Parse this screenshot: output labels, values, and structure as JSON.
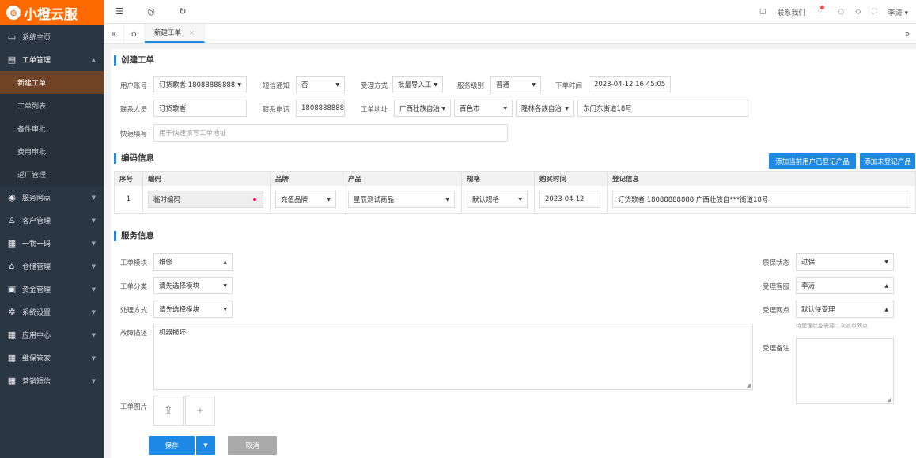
{
  "brand": {
    "name": "小橙云服",
    "mark": "⊙"
  },
  "sidebar": {
    "items": [
      {
        "label": "系统主页",
        "icon": "monitor-icon",
        "glyph": "▭"
      },
      {
        "label": "工单管理",
        "icon": "document-icon",
        "glyph": "▤",
        "open": true,
        "children": [
          "新建工单",
          "工单列表",
          "备件审批",
          "费用审批",
          "返厂管理"
        ]
      },
      {
        "label": "服务网点",
        "icon": "globe-icon",
        "glyph": "◉"
      },
      {
        "label": "客户管理",
        "icon": "user-icon",
        "glyph": "♙"
      },
      {
        "label": "一物一码",
        "icon": "grid-icon",
        "glyph": "▦"
      },
      {
        "label": "仓储管理",
        "icon": "bank-icon",
        "glyph": "⌂"
      },
      {
        "label": "资金管理",
        "icon": "money-icon",
        "glyph": "▣"
      },
      {
        "label": "系统设置",
        "icon": "gear-icon",
        "glyph": "✲"
      },
      {
        "label": "应用中心",
        "icon": "apps-icon",
        "glyph": "▦"
      },
      {
        "label": "维保管家",
        "icon": "apps-icon",
        "glyph": "▦"
      },
      {
        "label": "营销短信",
        "icon": "apps-icon",
        "glyph": "▦"
      }
    ]
  },
  "topbar": {
    "contact": "联系我们",
    "user": "李涛"
  },
  "tabs": {
    "active": "新建工单"
  },
  "create": {
    "title": "创建工单",
    "user_account_label": "用户账号",
    "user_account": "订货歌者 18088888888",
    "sms_label": "短信通知",
    "sms": "否",
    "accept_label": "受理方式",
    "accept": "批量导入工",
    "level_label": "服务级别",
    "level": "普通",
    "order_time_label": "下单时间",
    "order_time": "2023-04-12 16:45:05",
    "contact_label": "联系人员",
    "contact": "订货歌者",
    "phone_label": "联系电话",
    "phone": "18088888888",
    "address_label": "工单地址",
    "province": "广西壮族自治",
    "city": "百色市",
    "county": "隆林各族自治",
    "street": "东门东街道18号",
    "quick_label": "快速填写",
    "quick_placeholder": "用于快速填写工单地址"
  },
  "coding": {
    "title": "编码信息",
    "add_registered": "添加当前用户已登记产品",
    "add_unregistered": "添加未登记产品",
    "headers": [
      "序号",
      "编码",
      "品牌",
      "产品",
      "规格",
      "购买时间",
      "登记信息"
    ],
    "rows": [
      {
        "index": "1",
        "code": "临时编码",
        "brand": "充值品牌",
        "product": "星辰测试商品",
        "spec": "默认规格",
        "date": "2023-04-12",
        "info": "订货歌者 18088888888 广西壮族自***街道18号"
      }
    ]
  },
  "service": {
    "title": "服务信息",
    "module_label": "工单模块",
    "module": "维修",
    "category_label": "工单分类",
    "category": "请先选择模块",
    "method_label": "处理方式",
    "method": "请先选择模块",
    "fault_label": "故障描述",
    "fault": "机器损坏",
    "image_label": "工单图片",
    "warranty_label": "质保状态",
    "warranty": "过保",
    "agent_label": "受理客服",
    "agent": "李涛",
    "outlet_label": "受理网点",
    "outlet": "默认待受理",
    "outlet_hint": "待受理状态需要二次派单网点",
    "remark_label": "受理备注",
    "save": "保存",
    "cancel": "取消"
  }
}
